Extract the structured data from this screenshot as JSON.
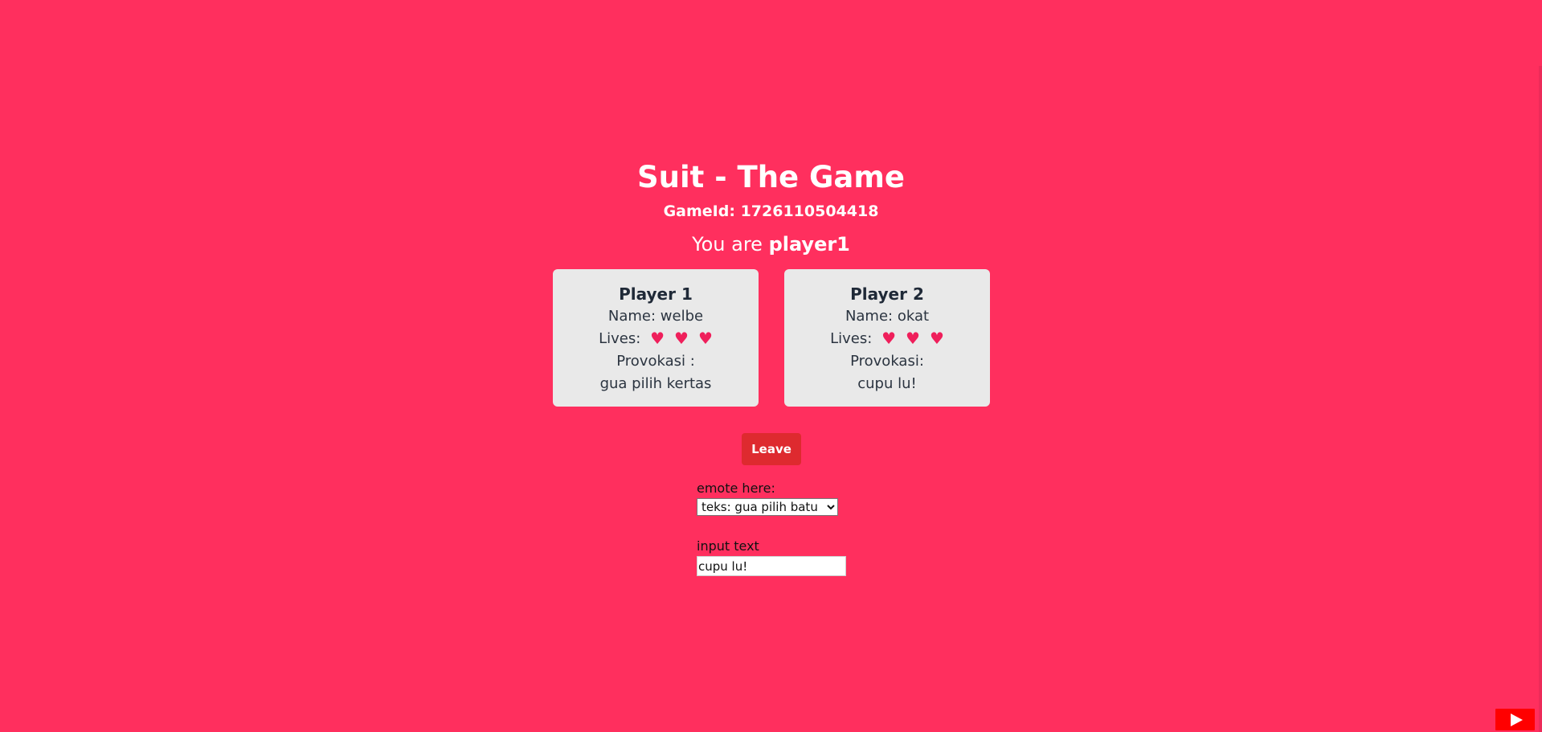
{
  "header": {
    "title": "Suit - The Game",
    "game_id_label": "GameId:",
    "game_id_value": "1726110504418",
    "role_prefix": "You are",
    "role_value": "player1"
  },
  "players": [
    {
      "title": "Player 1",
      "name_label": "Name:",
      "name_value": "welbe",
      "lives_label": "Lives:",
      "lives_count": 3,
      "provokasi_label": "Provokasi :",
      "provokasi_value": "gua pilih kertas"
    },
    {
      "title": "Player 2",
      "name_label": "Name:",
      "name_value": "okat",
      "lives_label": "Lives:",
      "lives_count": 3,
      "provokasi_label": "Provokasi:",
      "provokasi_value": "cupu lu!"
    }
  ],
  "controls": {
    "leave_label": "Leave",
    "emote_label": "emote here:",
    "emote_selected": "teks: gua pilih batu",
    "input_label": "input text",
    "input_value": "cupu lu!"
  },
  "icons": {
    "heart": "heart-icon",
    "play": "play-icon"
  },
  "colors": {
    "background": "#ff2f5e",
    "card": "#e9e9e9",
    "leave_button": "#de2a2f",
    "heart": "#ef1f5b",
    "youtube": "#ff0000"
  }
}
